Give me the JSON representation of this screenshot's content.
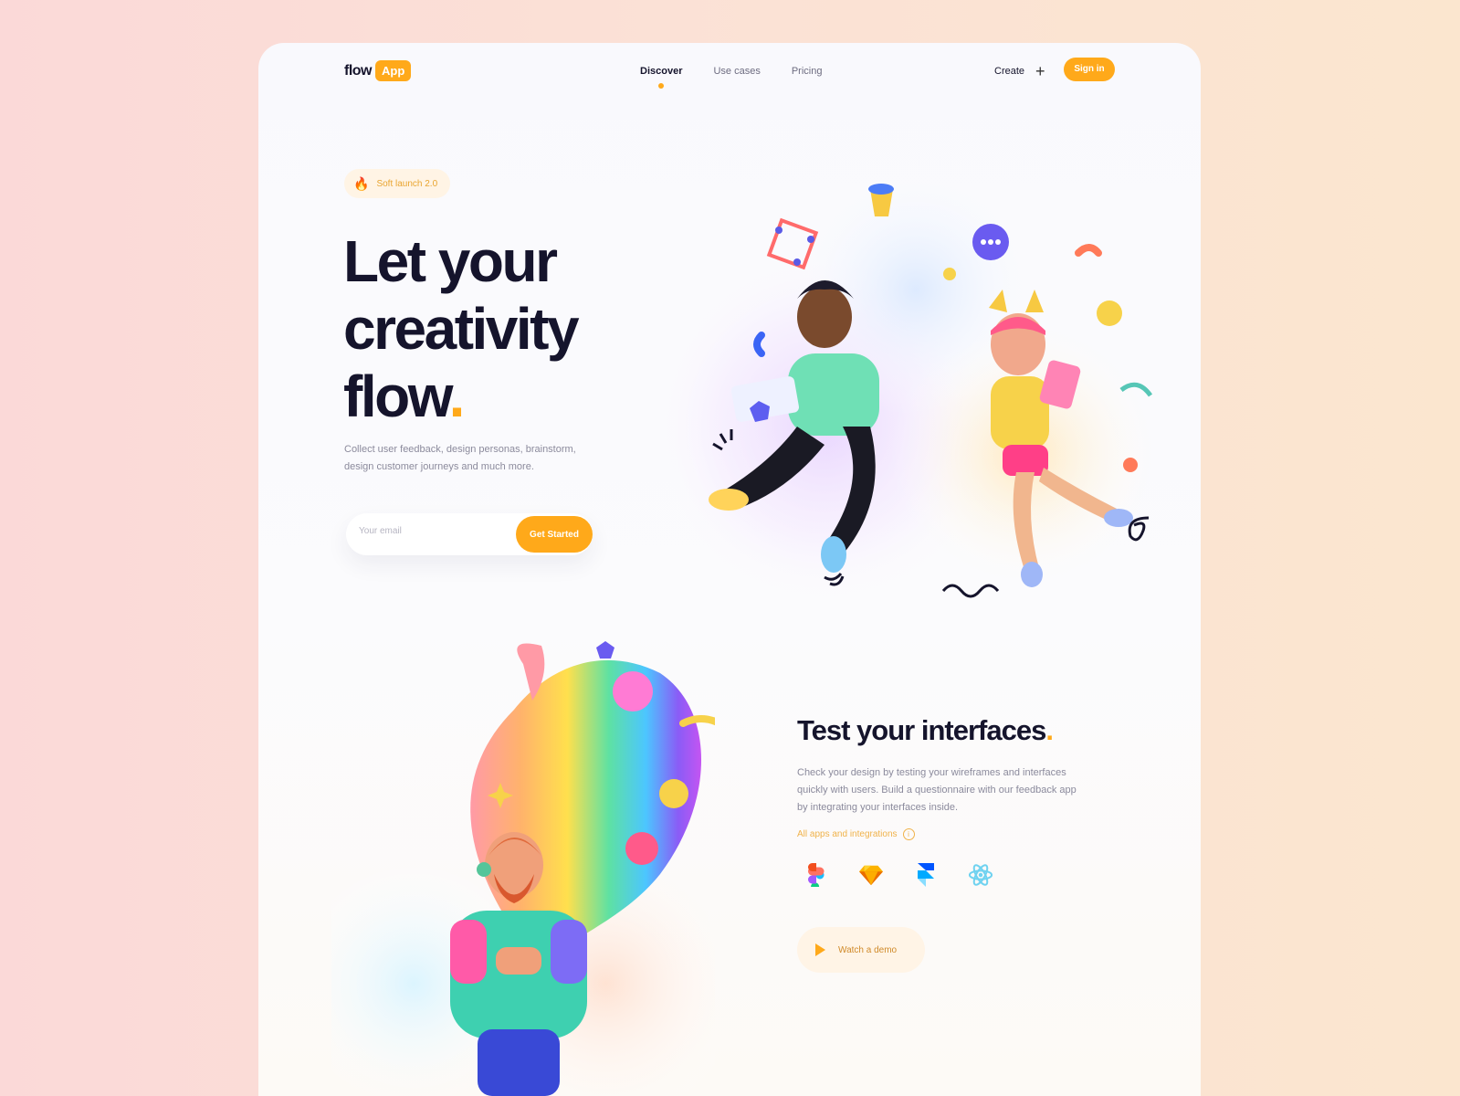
{
  "nav": {
    "logo_word": "flow",
    "logo_badge": "App",
    "items": [
      {
        "label": "Discover",
        "active": true
      },
      {
        "label": "Use cases",
        "active": false
      },
      {
        "label": "Pricing",
        "active": false
      }
    ],
    "create_label": "Create",
    "signin_label": "Sign in"
  },
  "hero": {
    "badge": "Soft launch 2.0",
    "title_line1": "Let your",
    "title_line2": "creativity",
    "title_line3": "flow",
    "title_dot": ".",
    "description": "Collect user feedback, design personas, brainstorm, design customer journeys and much more.",
    "email_placeholder": "Your email",
    "cta_label": "Get Started"
  },
  "section2": {
    "title": "Test your interfaces",
    "title_dot": ".",
    "description": "Check your design by testing your wireframes and interfaces quickly with users. Build a questionnaire with our feedback app by integrating your interfaces inside.",
    "integrations_label": "All apps and integrations",
    "app_icons": [
      "figma-icon",
      "sketch-icon",
      "framer-icon",
      "react-icon"
    ],
    "demo_label": "Watch a demo"
  },
  "colors": {
    "accent": "#ffa91a",
    "text_dark": "#15142c",
    "text_muted": "#8b8a9c"
  }
}
